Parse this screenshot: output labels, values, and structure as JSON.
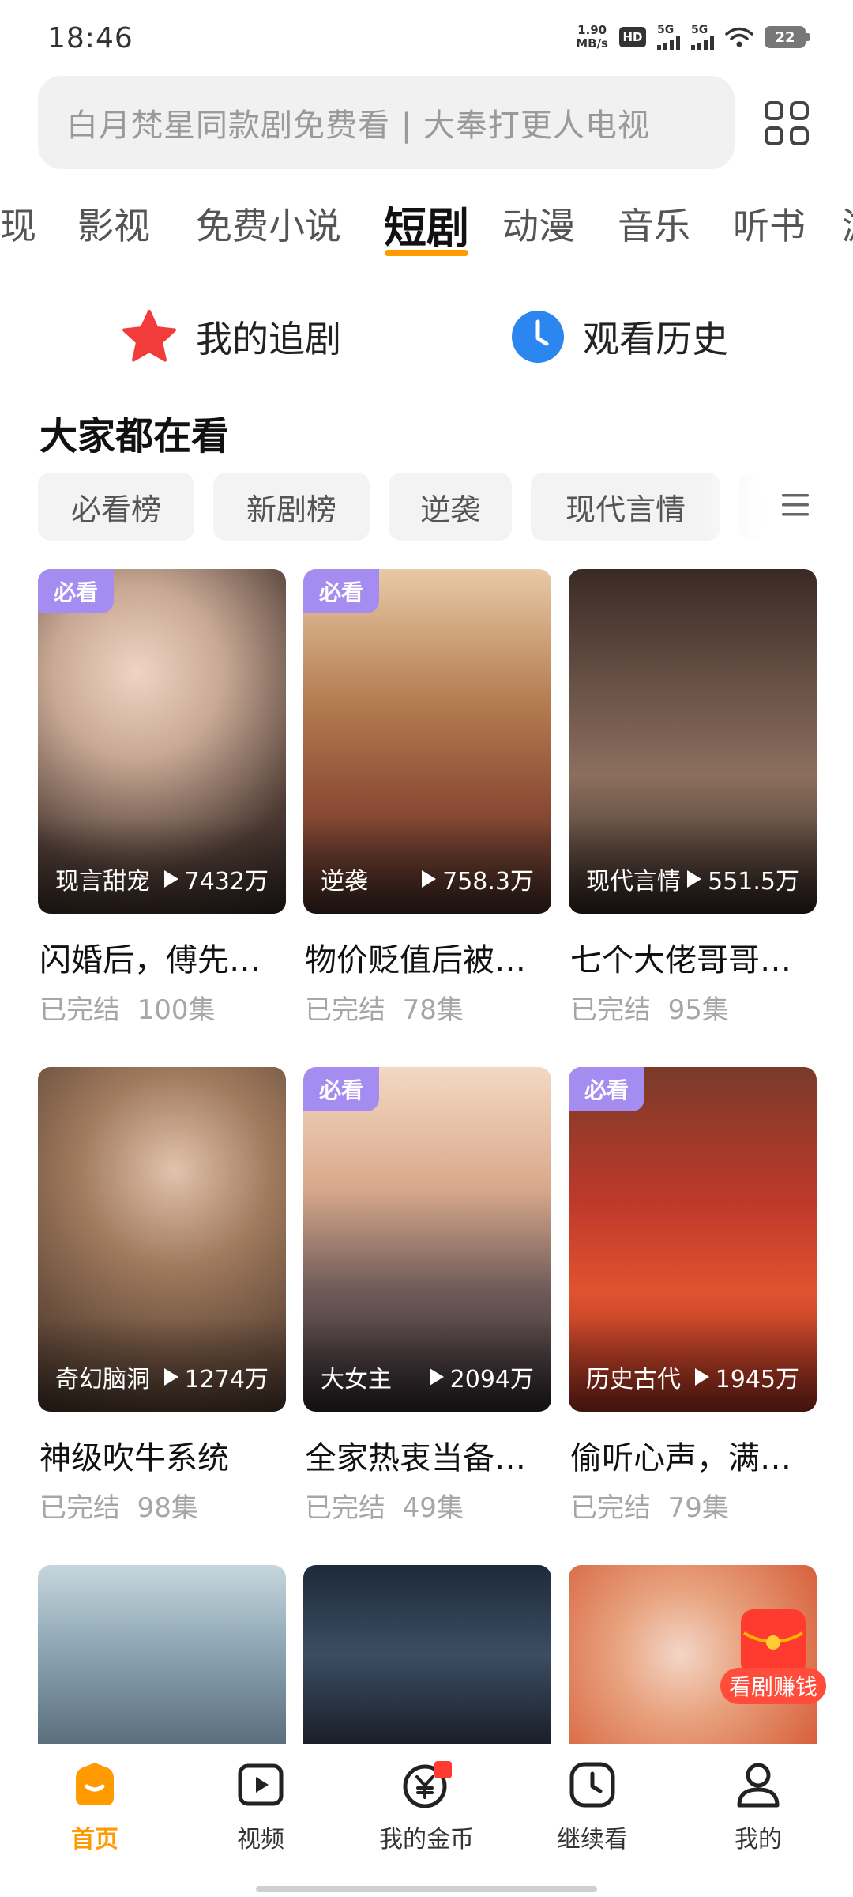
{
  "status_bar": {
    "time": "18:46",
    "net_speed_value": "1.90",
    "net_speed_unit": "MB/s",
    "hd_label": "HD",
    "sim1_label": "5G",
    "sim2_label": "5G",
    "battery": "22"
  },
  "search": {
    "placeholder": "白月梵星同款剧免费看 | 大奉打更人电视"
  },
  "header": {
    "grid_icon": "grid-icon"
  },
  "tabs": [
    {
      "label": "现"
    },
    {
      "label": "影视"
    },
    {
      "label": "免费小说"
    },
    {
      "label": "短剧"
    },
    {
      "label": "动漫"
    },
    {
      "label": "音乐"
    },
    {
      "label": "听书"
    },
    {
      "label": "游"
    }
  ],
  "active_tab": "短剧",
  "quick_entries": {
    "follow": {
      "label": "我的追剧",
      "icon": "star-icon",
      "color": "#f23b3b"
    },
    "history": {
      "label": "观看历史",
      "icon": "clock-icon",
      "color": "#2b86f0"
    }
  },
  "section": {
    "title": "大家都在看"
  },
  "filter_chips": [
    {
      "label": "必看榜"
    },
    {
      "label": "新剧榜"
    },
    {
      "label": "逆袭"
    },
    {
      "label": "现代言情"
    },
    {
      "label": "扌"
    }
  ],
  "dramas": [
    {
      "badge": "必看",
      "genre": "现言甜宠",
      "plays": "7432万",
      "title": "闪婚后，傅先…",
      "status": "已完结",
      "episodes": "100集"
    },
    {
      "badge": "必看",
      "genre": "逆袭",
      "plays": "758.3万",
      "title": "物价贬值后被…",
      "status": "已完结",
      "episodes": "78集"
    },
    {
      "badge": "",
      "genre": "现代言情",
      "plays": "551.5万",
      "title": "七个大佬哥哥…",
      "status": "已完结",
      "episodes": "95集"
    },
    {
      "badge": "",
      "genre": "奇幻脑洞",
      "plays": "1274万",
      "title": "神级吹牛系统",
      "status": "已完结",
      "episodes": "98集"
    },
    {
      "badge": "必看",
      "genre": "大女主",
      "plays": "2094万",
      "title": "全家热衷当备…",
      "status": "已完结",
      "episodes": "49集"
    },
    {
      "badge": "必看",
      "genre": "历史古代",
      "plays": "1945万",
      "title": "偷听心声，满…",
      "status": "已完结",
      "episodes": "79集"
    }
  ],
  "promo": {
    "earn_label": "看剧赚钱"
  },
  "bottom_nav": [
    {
      "label": "首页",
      "icon": "home-icon"
    },
    {
      "label": "视频",
      "icon": "video-play-icon"
    },
    {
      "label": "我的金币",
      "icon": "coin-icon"
    },
    {
      "label": "继续看",
      "icon": "continue-clock-icon"
    },
    {
      "label": "我的",
      "icon": "profile-icon"
    }
  ],
  "colors": {
    "accent": "#ff9a00",
    "badge": "#a58cf0",
    "earn": "#ff4c3b"
  }
}
